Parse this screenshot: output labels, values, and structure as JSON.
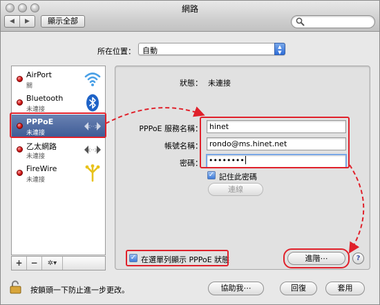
{
  "window": {
    "title": "網路",
    "nav_back_glyph": "◀",
    "nav_forward_glyph": "▶",
    "show_all_label": "顯示全部",
    "search_placeholder": ""
  },
  "location": {
    "label": "所在位置：",
    "value": "自動"
  },
  "services": [
    {
      "name": "AirPort",
      "status": "關",
      "icon": "wifi-icon",
      "selected": false
    },
    {
      "name": "Bluetooth",
      "status": "未連接",
      "icon": "bluetooth-icon",
      "selected": false
    },
    {
      "name": "PPPoE",
      "status": "未連接",
      "icon": "ethernet-arrows-icon",
      "selected": true
    },
    {
      "name": "乙太網路",
      "status": "未連接",
      "icon": "ethernet-arrows-icon",
      "selected": false
    },
    {
      "name": "FireWire",
      "status": "未連接",
      "icon": "firewire-icon",
      "selected": false
    }
  ],
  "sidebar_toolbar": {
    "add": "+",
    "remove": "−",
    "action": "✲▾"
  },
  "detail": {
    "status_label": "狀態：",
    "status_value": "未連接",
    "service_name_label": "PPPoE 服務名稱：",
    "service_name_value": "hinet",
    "account_label": "帳號名稱：",
    "account_value": "rondo@ms.hinet.net",
    "password_label": "密碼：",
    "password_value": "••••••••",
    "remember_password_label": "記住此密碼",
    "remember_password_checked": true,
    "connect_button": "連線",
    "show_in_menubar_label": "在選單列顯示 PPPoE 狀態",
    "show_in_menubar_checked": true,
    "advanced_button": "進階⋯",
    "help_button": "?"
  },
  "bottom": {
    "lock_text": "按鎖頭一下防止進一步更改。",
    "assist_button": "協助我⋯",
    "revert_button": "回復",
    "apply_button": "套用"
  },
  "colors": {
    "highlight_red": "#e0202a",
    "selection_blue": "#3c5a95",
    "status_dot_red": "#d01616"
  }
}
